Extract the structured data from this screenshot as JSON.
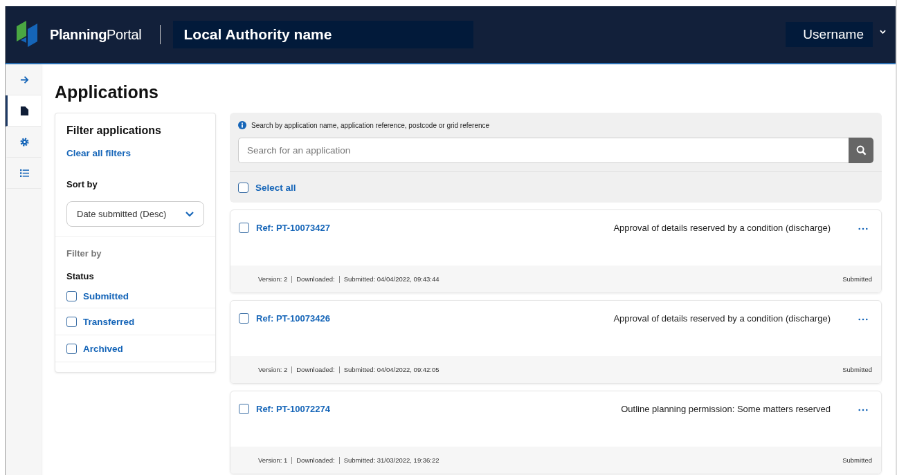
{
  "header": {
    "brand_strong": "Planning",
    "brand_light": "Portal",
    "authority": "Local Authority name",
    "username": "Username"
  },
  "rail": [
    {
      "kind": "arrow",
      "selected": false
    },
    {
      "kind": "document",
      "selected": true
    },
    {
      "kind": "settings",
      "selected": false
    },
    {
      "kind": "list",
      "selected": false
    }
  ],
  "page_title": "Applications",
  "filter": {
    "title": "Filter applications",
    "clear": "Clear all filters",
    "sort_label": "Sort by",
    "sort_value": "Date submitted (Desc)",
    "filter_by": "Filter by",
    "status_label": "Status",
    "statuses": [
      {
        "label": "Submitted",
        "checked": false
      },
      {
        "label": "Transferred",
        "checked": false
      },
      {
        "label": "Archived",
        "checked": false
      }
    ]
  },
  "search": {
    "hint": "Search by application name, application reference, postcode or grid reference",
    "placeholder": "Search for an application",
    "select_all": "Select all",
    "select_all_checked": false
  },
  "applications": [
    {
      "ref": "Ref: PT-10073427",
      "type": "Approval of details reserved by a condition (discharge)",
      "version": "Version: 2",
      "downloaded": "Downloaded:",
      "submitted": "Submitted: 04/04/2022, 09:43:44",
      "status": "Submitted",
      "checked": false
    },
    {
      "ref": "Ref: PT-10073426",
      "type": "Approval of details reserved by a condition (discharge)",
      "version": "Version: 2",
      "downloaded": "Downloaded:",
      "submitted": "Submitted: 04/04/2022, 09:42:05",
      "status": "Submitted",
      "checked": false
    },
    {
      "ref": "Ref: PT-10072274",
      "type": "Outline planning permission: Some matters reserved",
      "version": "Version: 1",
      "downloaded": "Downloaded:",
      "submitted": "Submitted: 31/03/2022, 19:36:22",
      "status": "Submitted",
      "checked": false
    }
  ]
}
